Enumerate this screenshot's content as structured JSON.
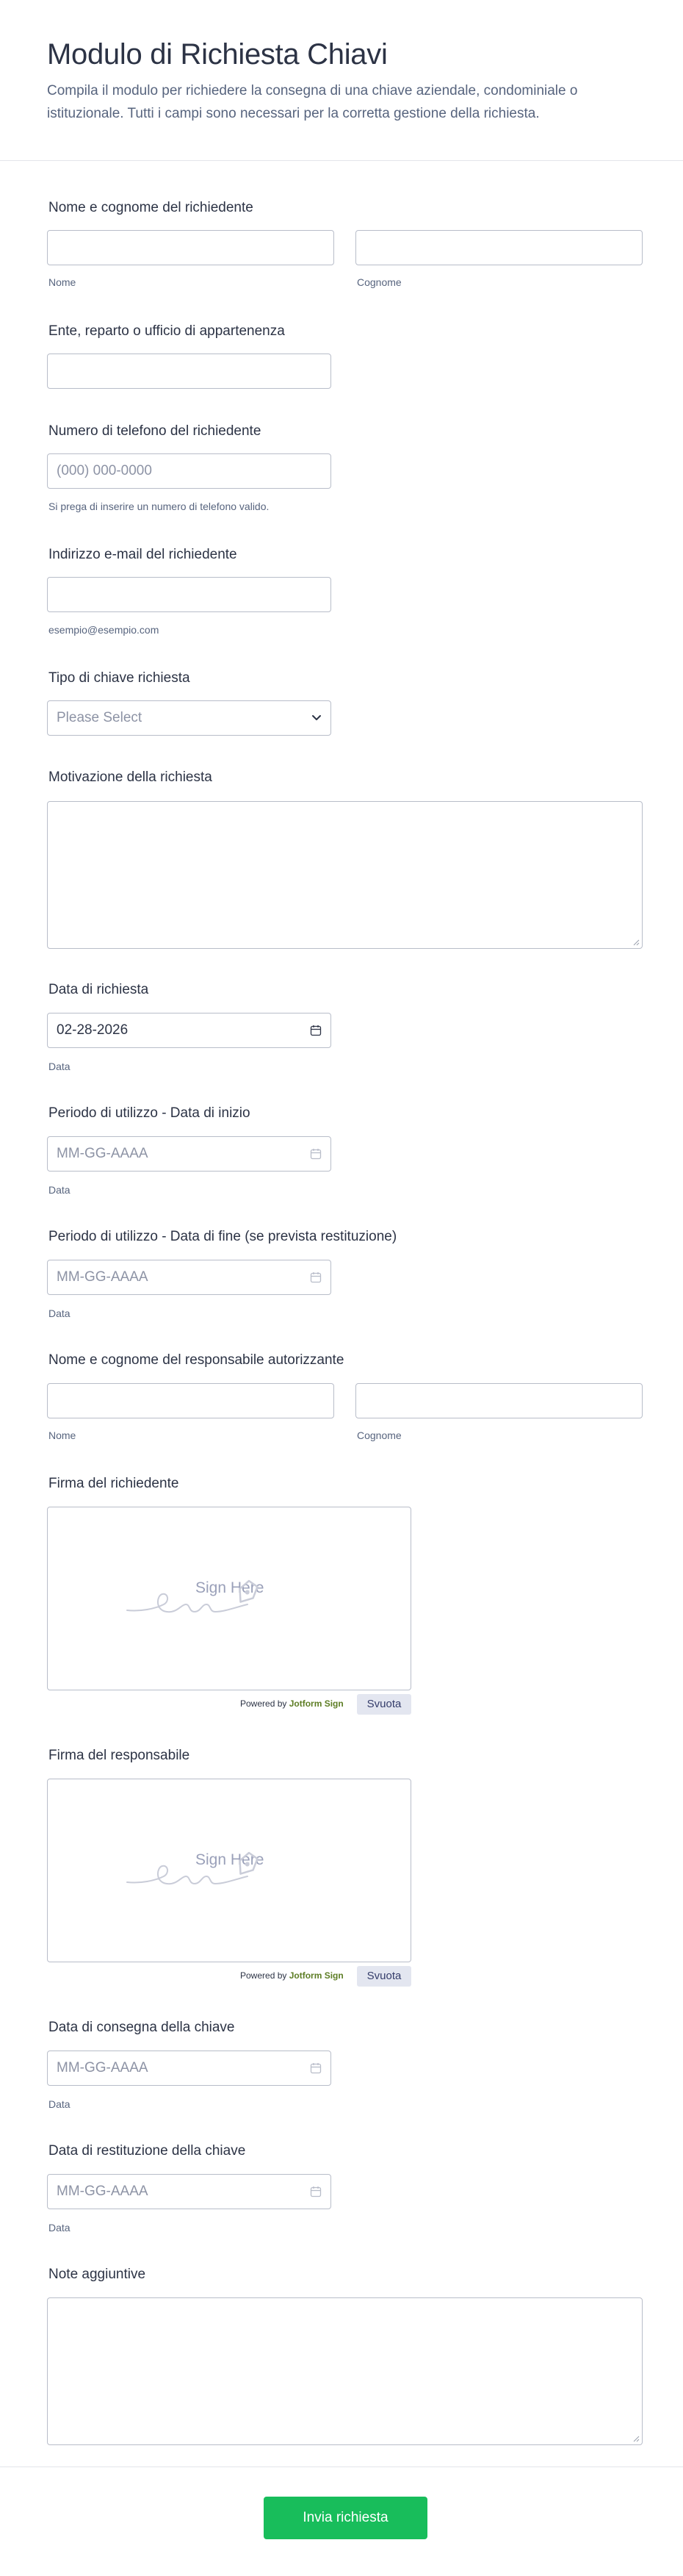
{
  "header": {
    "title": "Modulo di Richiesta Chiavi",
    "subtitle": "Compila il modulo per richiedere la consegna di una chiave aziendale, condominiale o istituzionale. Tutti i campi sono necessari per la corretta gestione della richiesta."
  },
  "fields": {
    "requester_name": {
      "label": "Nome e cognome del richiedente",
      "first_sub": "Nome",
      "last_sub": "Cognome"
    },
    "department": {
      "label": "Ente, reparto o ufficio di appartenenza"
    },
    "phone": {
      "label": "Numero di telefono del richiedente",
      "placeholder": "(000) 000-0000",
      "sub": "Si prega di inserire un numero di telefono valido."
    },
    "email": {
      "label": "Indirizzo e-mail del richiedente",
      "sub": "esempio@esempio.com"
    },
    "key_type": {
      "label": "Tipo di chiave richiesta",
      "placeholder": "Please Select"
    },
    "reason": {
      "label": "Motivazione della richiesta"
    },
    "request_date": {
      "label": "Data di richiesta",
      "value": "02-28-2026",
      "sub": "Data"
    },
    "start_date": {
      "label": "Periodo di utilizzo - Data di inizio",
      "placeholder": "MM-GG-AAAA",
      "sub": "Data"
    },
    "end_date": {
      "label": "Periodo di utilizzo - Data di fine (se prevista restituzione)",
      "placeholder": "MM-GG-AAAA",
      "sub": "Data"
    },
    "authorizer_name": {
      "label": "Nome e cognome del responsabile autorizzante",
      "first_sub": "Nome",
      "last_sub": "Cognome"
    },
    "requester_signature": {
      "label": "Firma del richiedente",
      "sign_here": "Sign Here",
      "powered_prefix": "Powered by ",
      "powered_brand": "Jotform Sign",
      "clear": "Svuota"
    },
    "manager_signature": {
      "label": "Firma del responsabile",
      "sign_here": "Sign Here",
      "powered_prefix": "Powered by ",
      "powered_brand": "Jotform Sign",
      "clear": "Svuota"
    },
    "delivery_date": {
      "label": "Data di consegna della chiave",
      "placeholder": "MM-GG-AAAA",
      "sub": "Data"
    },
    "return_date": {
      "label": "Data di restituzione della chiave",
      "placeholder": "MM-GG-AAAA",
      "sub": "Data"
    },
    "notes": {
      "label": "Note aggiuntive"
    }
  },
  "footer": {
    "submit_label": "Invia richiesta"
  },
  "colors": {
    "submit": "#18bd5b",
    "text": "#2c3345",
    "muted": "#57647e",
    "placeholder": "#8d93a5",
    "border": "#b8bdc9",
    "brand_green": "#5d7d24"
  },
  "icons": {
    "calendar": "calendar-icon",
    "dropdown": "chevron-down-icon",
    "signature": "pen-nib-icon"
  }
}
